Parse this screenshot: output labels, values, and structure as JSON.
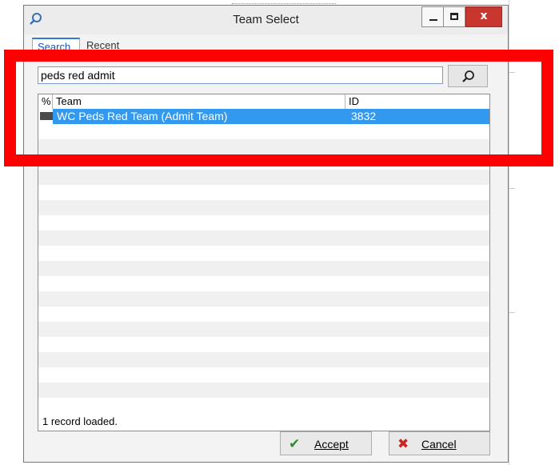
{
  "window": {
    "title": "Team Select",
    "controls": {
      "minimize": "minimize",
      "maximize": "maximize",
      "close": "x"
    }
  },
  "tabs": [
    {
      "label": "Search",
      "active": true
    },
    {
      "label": "Recent",
      "active": false
    }
  ],
  "search": {
    "value": "peds red admit",
    "button_icon": "magnifier-icon"
  },
  "table": {
    "columns": [
      "%",
      "Team",
      "ID"
    ],
    "rows": [
      {
        "team": "WC Peds Red Team (Admit Team)",
        "id": "3832",
        "selected": true
      }
    ]
  },
  "status": "1 record loaded.",
  "footer": {
    "accept_label": "Accept",
    "cancel_label": "Cancel"
  },
  "colors": {
    "selection": "#3399ee",
    "annotation": "#ff0000",
    "accept_icon": "#2e8b2e",
    "cancel_icon": "#c8281f"
  }
}
